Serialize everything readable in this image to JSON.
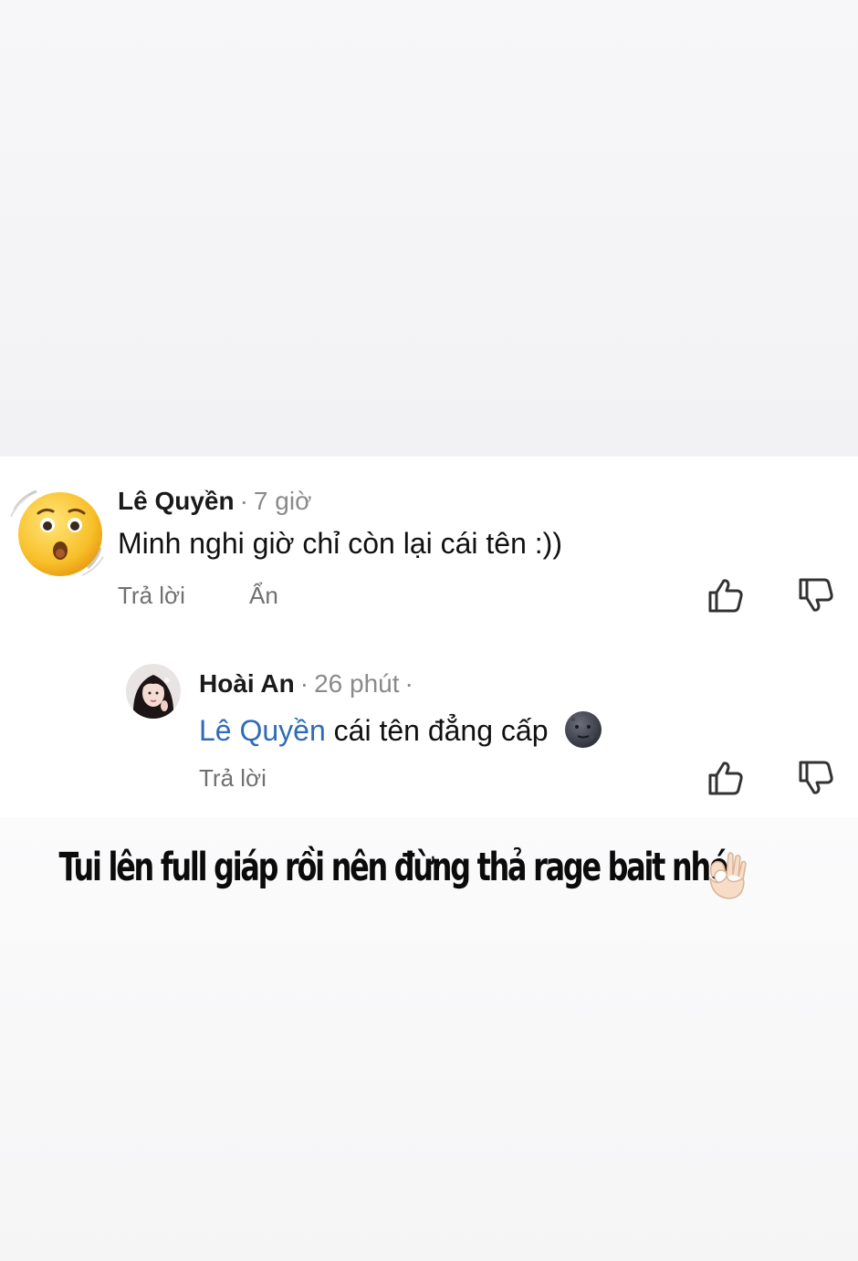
{
  "comments": [
    {
      "author": "Lê Quyền",
      "time": "7 giờ",
      "text": "Minh nghi giờ chỉ còn lại cái tên :))",
      "actions": {
        "reply": "Trả lời",
        "hide": "Ẩn"
      },
      "avatar": "hushed-face-emoji-icon"
    },
    {
      "author": "Hoài An",
      "time": "26 phút",
      "mention": "Lê Quyền",
      "text": " cái tên đẳng cấp",
      "emoji": "new-moon-face-icon",
      "actions": {
        "reply": "Trả lời"
      },
      "avatar": "profile-photo"
    }
  ],
  "caption": {
    "text": "Tui lên full giáp rồi nên đừng thả rage bait nhé",
    "emoji": "ok-hand-icon"
  },
  "colors": {
    "mention": "#2f6cb5",
    "meta": "#8a8a8a",
    "action": "#707070",
    "card": "#ffffff",
    "background": "#f3f3f5"
  }
}
